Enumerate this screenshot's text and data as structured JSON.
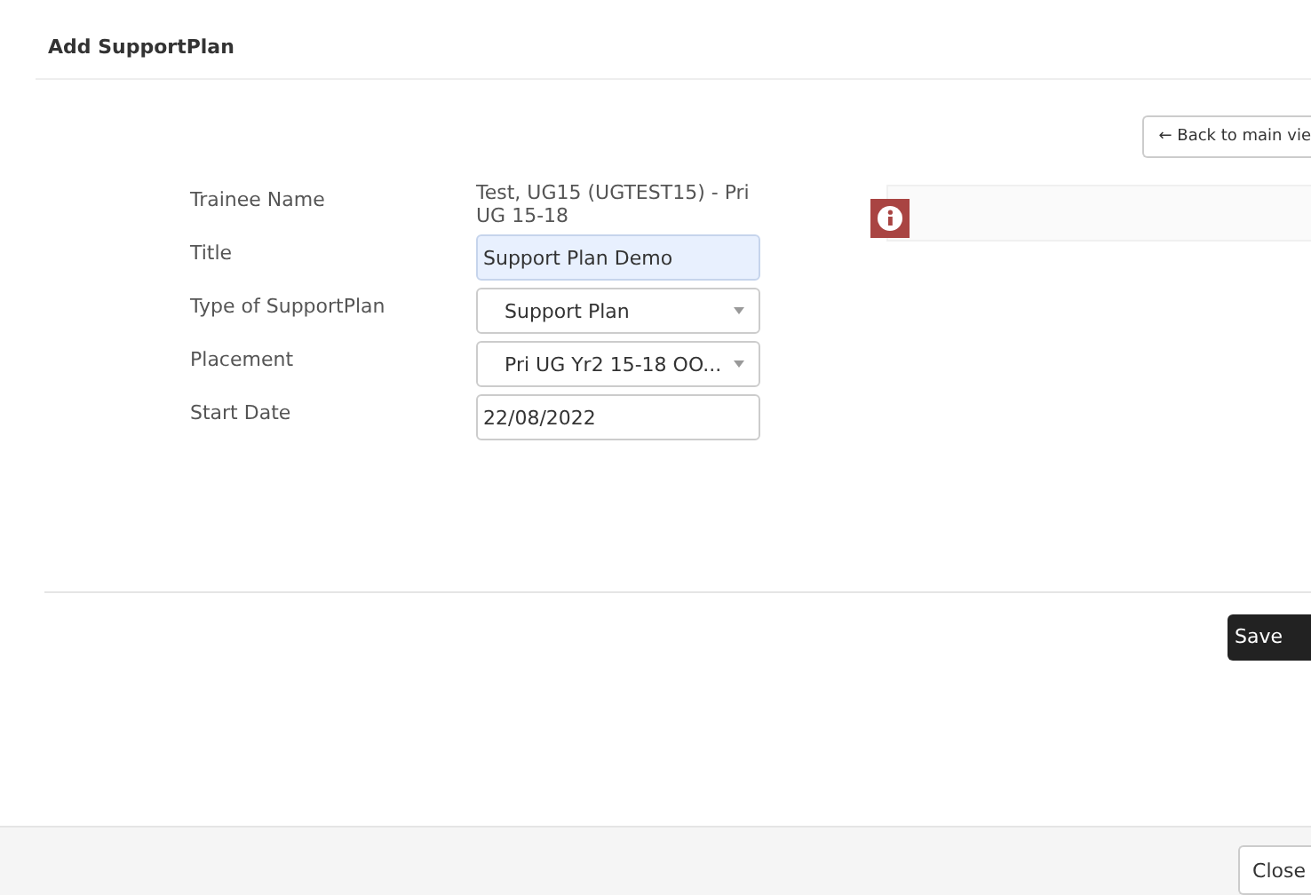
{
  "dialog": {
    "title": "Add SupportPlan"
  },
  "back_button": {
    "icon": "←",
    "label": "Back to main vie"
  },
  "form": [
    {
      "label": "Trainee Name",
      "kind": "text",
      "value": "Test, UG15 (UGTEST15) - Pri UG 15-18"
    },
    {
      "label": "Title",
      "kind": "input",
      "value": "Support Plan Demo",
      "highlighted": true
    },
    {
      "label": "Type of SupportPlan",
      "kind": "select",
      "value": "Support Plan"
    },
    {
      "label": "Placement",
      "kind": "select",
      "value": "Pri UG Yr2 15-18 OO..."
    },
    {
      "label": "Start Date",
      "kind": "input",
      "value": "22/08/2022",
      "highlighted": false
    }
  ],
  "save_button": "Save",
  "close_button": "Close"
}
